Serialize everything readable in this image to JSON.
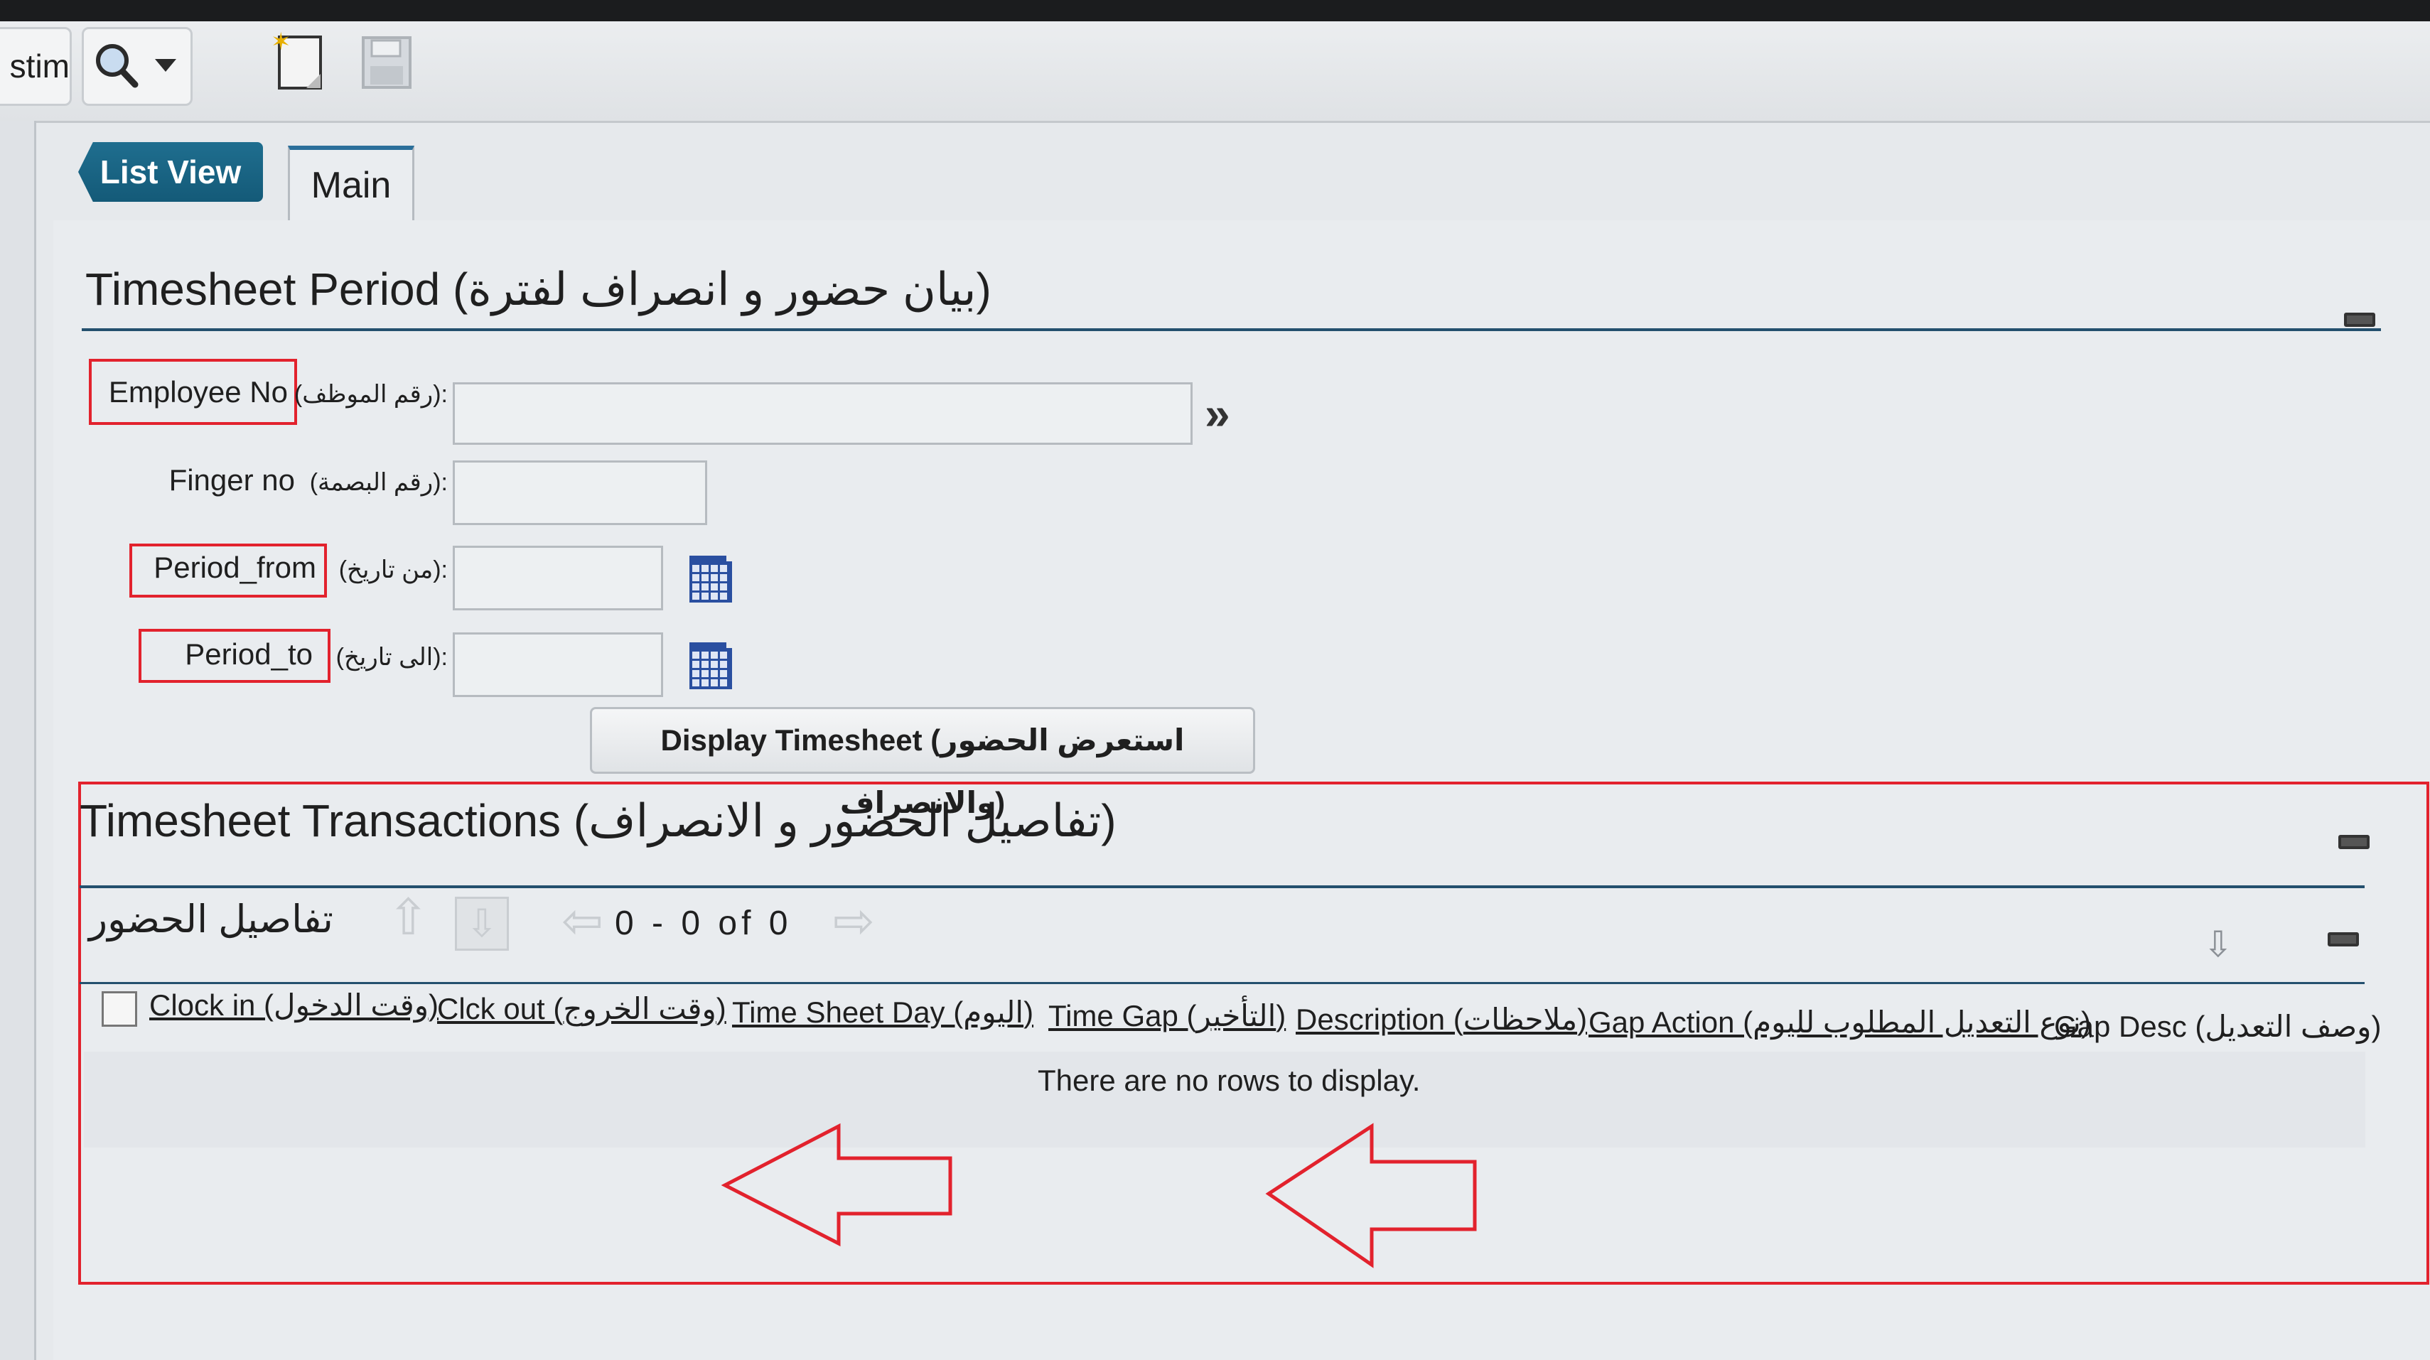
{
  "toolbar": {
    "search_label": "stim",
    "icons": [
      "search-icon",
      "chevron-down-icon",
      "new-record-icon",
      "save-icon"
    ]
  },
  "tabs": {
    "list_view": "List View",
    "main": "Main"
  },
  "timesheet_period": {
    "title": "Timesheet Period (بيان حضور و انصراف لفترة)",
    "fields": {
      "employee_no": {
        "label": "Employee No",
        "label_ar": "(رقم الموظف):",
        "value": ""
      },
      "finger_no": {
        "label": "Finger no",
        "label_ar": "(رقم البصمة):",
        "value": ""
      },
      "period_from": {
        "label": "Period_from",
        "label_ar": "(من تاريخ):",
        "value": ""
      },
      "period_to": {
        "label": "Period_to",
        "label_ar": "(الى تاريخ):",
        "value": ""
      }
    },
    "display_button": "Display Timesheet (استعرض الحضور والانصراف)"
  },
  "timesheet_transactions": {
    "title": "Timesheet Transactions (تفاصيل الحضور و الانصراف)",
    "subtitle": "تفاصيل الحضور",
    "pager": "0 - 0 of 0",
    "columns": [
      "Clock in (وقت الدخول)",
      "Clck out (وقت الخروج)",
      "Time Sheet Day (اليوم)",
      "Time Gap (التأخير)",
      "Description (ملاحظات)",
      "Gap Action (نوع التعديل المطلوب لليوم)",
      "Gap Desc (وصف التعديل)"
    ],
    "empty_message": "There are no rows to display."
  },
  "colors": {
    "accent": "#1f6e8f",
    "annotation_red": "#e2222d",
    "section_line": "#24506e"
  }
}
